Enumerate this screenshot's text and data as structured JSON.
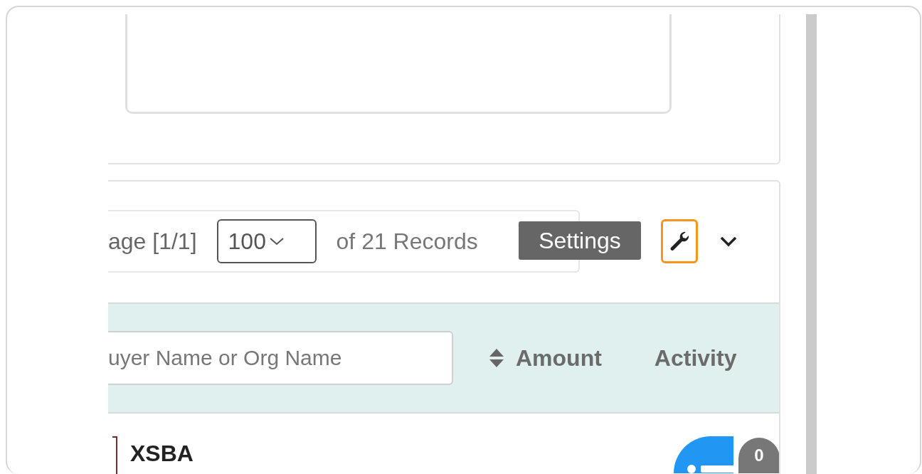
{
  "pager": {
    "page_label": "age [1/1]",
    "page_size": "100",
    "records": "of 21 Records"
  },
  "tooltip": {
    "text": "Settings"
  },
  "table": {
    "search": {
      "placeholder": "uyer Name or Org Name"
    },
    "columns": [
      {
        "label": "Amount",
        "sortable": true
      },
      {
        "label": "Activity",
        "sortable": false
      }
    ],
    "rows": [
      {
        "name": "XSBA",
        "activity_count": "0"
      }
    ]
  }
}
